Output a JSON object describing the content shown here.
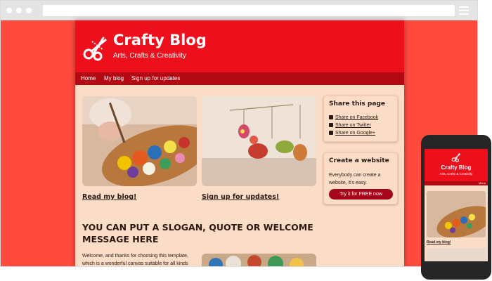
{
  "site": {
    "title": "Crafty Blog",
    "tagline": "Arts, Crafts & Creativity",
    "nav": [
      "Home",
      "My blog",
      "Sign up for updates"
    ]
  },
  "cards": [
    {
      "link": "Read my blog!",
      "image": "artist-palette-image"
    },
    {
      "link": "Sign up for updates!",
      "image": "hanging-knitted-toys-image"
    }
  ],
  "sidebar": {
    "share": {
      "title": "Share this page",
      "items": [
        {
          "icon": "facebook-icon",
          "label": "Share on Facebook"
        },
        {
          "icon": "twitter-icon",
          "label": "Share on Twitter"
        },
        {
          "icon": "google-plus-icon",
          "label": "Share on Google+"
        }
      ]
    },
    "create": {
      "title": "Create a website",
      "text": "Everybody can create a website, it's easy.",
      "button": "Try it for FREE now"
    }
  },
  "slogan": "YOU CAN PUT A SLOGAN, QUOTE OR WELCOME MESSAGE HERE",
  "welcome": "Welcome, and thanks for choosing this template, which is a wonderful canvas suitable for all kinds",
  "mobile": {
    "title": "Crafty Blog",
    "tagline": "Arts, Crafts & Creativity",
    "menu": "Menu",
    "link": "Read my blog!"
  },
  "colors": {
    "outer_background": "#ff4a3d",
    "header": "#ee0f1d",
    "nav": "#b30913",
    "page": "#fbdcc6",
    "button": "#a5061a"
  }
}
